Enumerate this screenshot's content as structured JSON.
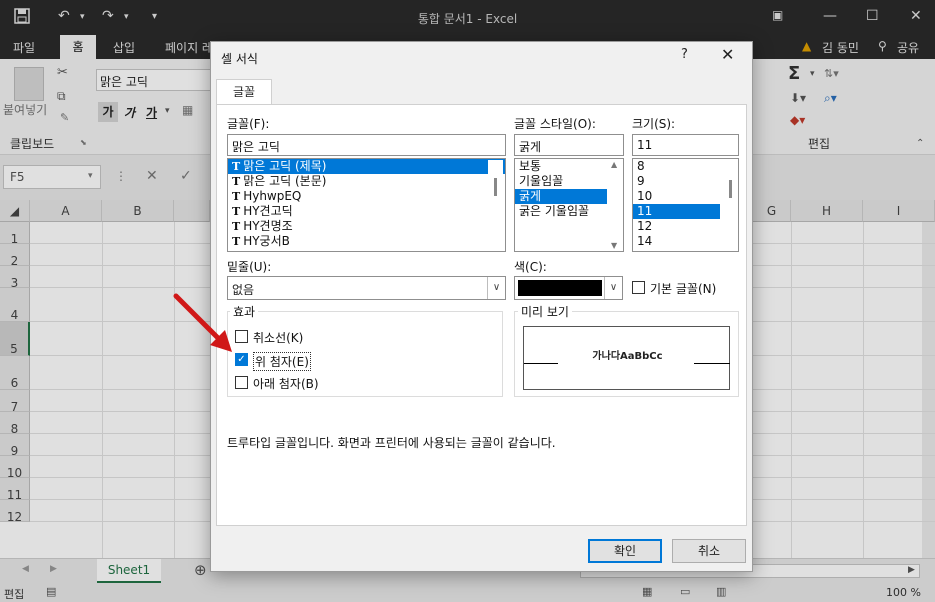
{
  "app": {
    "window_title": "통합 문서1 - Excel",
    "quick_access": {
      "save_icon": "save-icon",
      "undo_icon": "undo-icon",
      "redo_icon": "redo-icon",
      "customize": "▾"
    },
    "window_controls": {
      "minimize": "—",
      "maximize": "☐",
      "close": "✕"
    }
  },
  "ribbon": {
    "tabs": [
      "파일",
      "홈",
      "삽입",
      "페이지 레"
    ],
    "active_tab": "홈",
    "user": "김 동민",
    "share": "공유",
    "clipboard": {
      "paste": "붙여넣기",
      "group_label": "클립보드"
    },
    "font": {
      "font_name": "맑은 고딕",
      "bold": "가",
      "italic": "가",
      "underline": "가"
    },
    "editing": {
      "group_label": "편집",
      "autosum": "Σ"
    }
  },
  "formula_bar": {
    "name_box": "F5"
  },
  "grid": {
    "columns": [
      "A",
      "B",
      "G",
      "H",
      "I"
    ],
    "rows": [
      "1",
      "2",
      "3",
      "4",
      "5",
      "6",
      "7",
      "8",
      "9",
      "10",
      "11",
      "12"
    ]
  },
  "sheets": {
    "active": "Sheet1"
  },
  "status": {
    "mode": "편집",
    "zoom": "100 %"
  },
  "dialog": {
    "title": "셀 서식",
    "help": "?",
    "close": "✕",
    "tab": "글꼴",
    "font_label": "글꼴(F):",
    "font_value": "맑은 고딕",
    "font_list": [
      "맑은 고딕 (제목)",
      "맑은 고딕 (본문)",
      "HyhwpEQ",
      "HY견고딕",
      "HY견명조",
      "HY궁서B"
    ],
    "style_label": "글꼴 스타일(O):",
    "style_value": "굵게",
    "style_list": [
      "보통",
      "기울임꼴",
      "굵게",
      "굵은 기울임꼴"
    ],
    "size_label": "크기(S):",
    "size_value": "11",
    "size_list": [
      "8",
      "9",
      "10",
      "11",
      "12",
      "14"
    ],
    "underline_label": "밑줄(U):",
    "underline_value": "없음",
    "color_label": "색(C):",
    "color_value": "#000000",
    "normal_font_label": "기본 글꼴(N)",
    "effects_title": "효과",
    "strikethrough": "취소선(K)",
    "superscript": "위 첨자(E)",
    "subscript": "아래 첨자(B)",
    "preview_title": "미리 보기",
    "preview_text": "가나다AaBbCc",
    "description": "트루타입 글꼴입니다. 화면과 프린터에 사용되는 글꼴이 같습니다.",
    "ok": "확인",
    "cancel": "취소"
  },
  "colors": {
    "accent": "#0078d7",
    "excel_green": "#217346",
    "arrow": "#d01818"
  }
}
